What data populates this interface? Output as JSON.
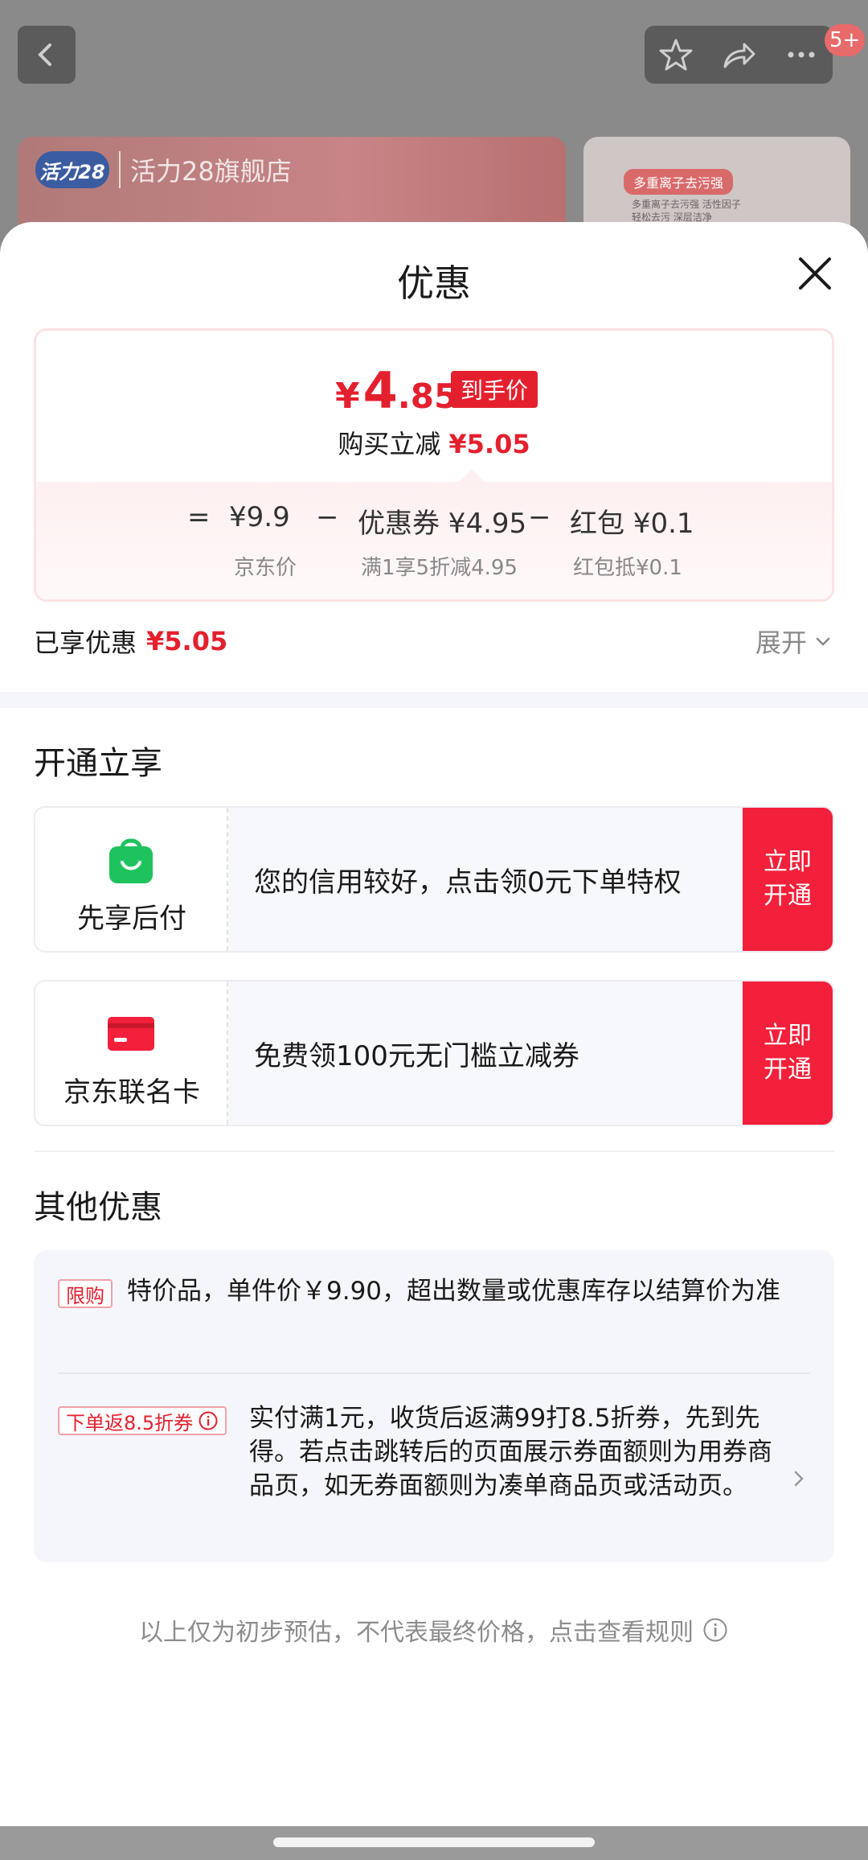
{
  "background": {
    "store_logo": "活力28",
    "store_name": "活力28旗舰店",
    "promo_tag": "多重离子去污强",
    "promo_small": "多重离子去污强 活性因子 轻松去污 深层洁净",
    "message_badge": "5+"
  },
  "sheet": {
    "title": "优惠",
    "final_price": {
      "currency": "¥",
      "integer": "4",
      "decimal": ".85",
      "tag": "到手价"
    },
    "save_line": {
      "label": "购买立减",
      "value": "¥5.05"
    },
    "formula": {
      "eq": "=",
      "jd_price": "¥9.9",
      "jd_price_label": "京东价",
      "minus1": "−",
      "coupon": "优惠券 ¥4.95",
      "coupon_label": "满1享5折减4.95",
      "minus2": "−",
      "redpacket": "红包 ¥0.1",
      "redpacket_label": "红包抵¥0.1"
    },
    "enjoyed": {
      "label": "已享优惠",
      "value": "¥5.05",
      "expand": "展开"
    },
    "open_section": {
      "title": "开通立享",
      "offers": [
        {
          "name": "先享后付",
          "text": "您的信用较好，点击领0元下单特权",
          "button": "立即\n开通"
        },
        {
          "name": "京东联名卡",
          "text": "免费领100元无门槛立减券",
          "button": "立即\n开通"
        }
      ]
    },
    "other_section": {
      "title": "其他优惠",
      "items": [
        {
          "badge": "限购",
          "text": "特价品，单件价￥9.90，超出数量或优惠库存以结算价为准"
        },
        {
          "badge": "下单返8.5折券",
          "text": "实付满1元，收货后返满99打8.5折券，先到先得。若点击跳转后的页面展示券面额则为用券商品页，如无券面额则为凑单商品页或活动页。"
        }
      ]
    },
    "footer": "以上仅为初步预估，不代表最终价格，点击查看规则"
  },
  "colors": {
    "accent": "#e4202e",
    "button": "#f2203a",
    "green": "#1fc35e"
  }
}
